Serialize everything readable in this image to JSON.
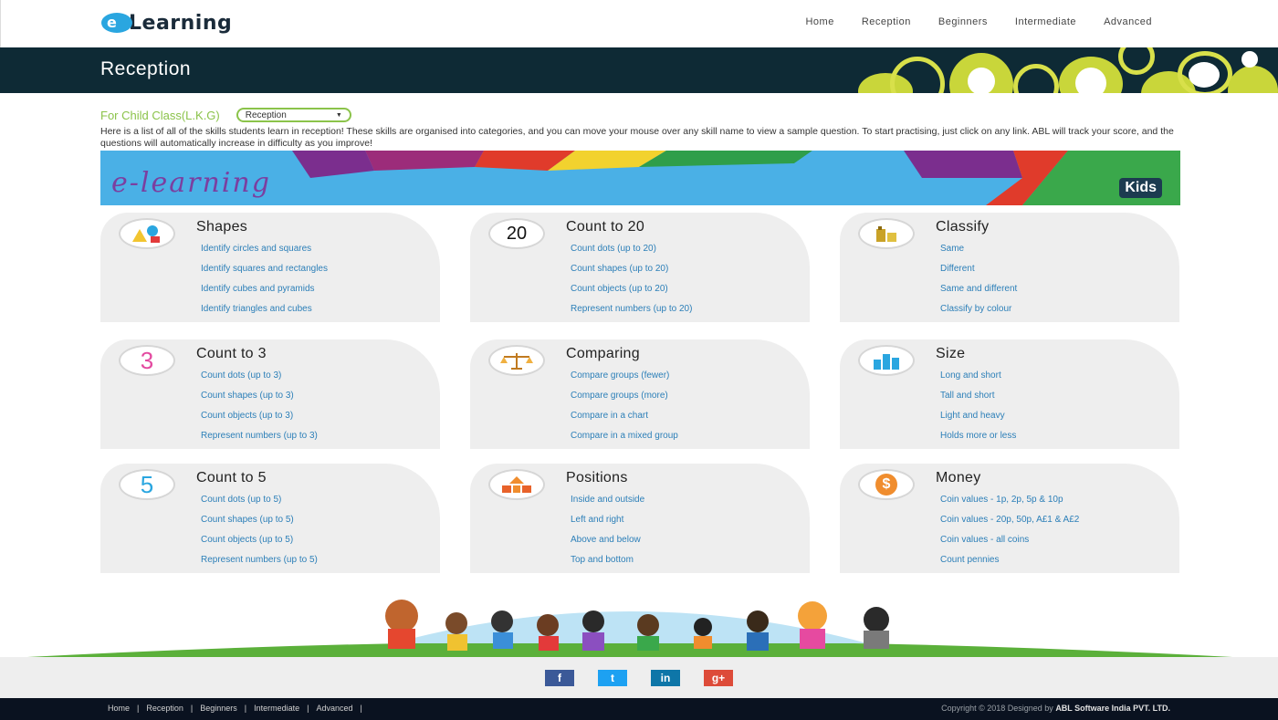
{
  "header": {
    "logo_badge": "e",
    "logo_text": "Learning",
    "nav": [
      "Home",
      "Reception",
      "Beginners",
      "Intermediate",
      "Advanced"
    ]
  },
  "banner": {
    "title": "Reception"
  },
  "intro": {
    "class_label": "For Child Class(L.K.G)",
    "select_value": "Reception",
    "description": "Here is a list of all of the skills students learn in reception! These skills are organised into categories, and you can move your mouse over any skill name to view a sample question. To start practising, just click on any link. ABL will track your score, and the questions will automatically increase in difficulty as you improve!"
  },
  "kids_banner": {
    "title": "e-learning",
    "badge": "Kids"
  },
  "cards": [
    {
      "title": "Shapes",
      "icon": "shapes-icon",
      "links": [
        "Identify circles and squares",
        "Identify squares and rectangles",
        "Identify cubes and pyramids",
        "Identify triangles and cubes"
      ]
    },
    {
      "title": "Count to 20",
      "icon": "number-20-icon",
      "icon_text": "20",
      "links": [
        "Count dots (up to 20)",
        "Count shapes (up to 20)",
        "Count objects (up to 20)",
        "Represent numbers (up to 20)"
      ]
    },
    {
      "title": "Classify",
      "icon": "classify-icon",
      "links": [
        "Same",
        "Different",
        "Same and different",
        "Classify by colour"
      ]
    },
    {
      "title": "Count to 3",
      "icon": "number-3-icon",
      "icon_text": "3",
      "links": [
        "Count dots (up to 3)",
        "Count shapes (up to 3)",
        "Count objects (up to 3)",
        "Represent numbers (up to 3)"
      ]
    },
    {
      "title": "Comparing",
      "icon": "scale-icon",
      "links": [
        "Compare groups (fewer)",
        "Compare groups (more)",
        "Compare in a chart",
        "Compare in a mixed group"
      ]
    },
    {
      "title": "Size",
      "icon": "bar-chart-icon",
      "links": [
        "Long and short",
        "Tall and short",
        "Light and heavy",
        "Holds more or less"
      ]
    },
    {
      "title": "Count to 5",
      "icon": "number-5-icon",
      "icon_text": "5",
      "links": [
        "Count dots (up to 5)",
        "Count shapes (up to 5)",
        "Count objects (up to 5)",
        "Represent numbers (up to 5)"
      ]
    },
    {
      "title": "Positions",
      "icon": "positions-icon",
      "links": [
        "Inside and outside",
        "Left and right",
        "Above and below",
        "Top and bottom"
      ]
    },
    {
      "title": "Money",
      "icon": "coin-icon",
      "icon_text": "$",
      "links": [
        "Coin values - 1p, 2p, 5p & 10p",
        "Coin values - 20p, 50p, A£1 & A£2",
        "Coin values - all coins",
        "Count pennies"
      ]
    }
  ],
  "social": [
    {
      "name": "facebook-icon",
      "label": "f",
      "color": "#3b5998"
    },
    {
      "name": "twitter-icon",
      "label": "t",
      "color": "#1da1f2"
    },
    {
      "name": "linkedin-icon",
      "label": "in",
      "color": "#0e76a8"
    },
    {
      "name": "google-plus-icon",
      "label": "g+",
      "color": "#dd4b39"
    }
  ],
  "footer": {
    "links": [
      "Home",
      "Reception",
      "Beginners",
      "Intermediate",
      "Advanced"
    ],
    "copyright": "Copyright © 2018 Designed by ",
    "company": "ABL Software India PVT. LTD."
  }
}
